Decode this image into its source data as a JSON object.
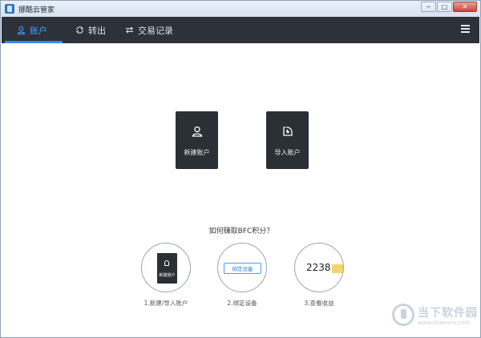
{
  "window": {
    "title": "挪酷云管家",
    "controls": {
      "minimize": "─",
      "maximize": "□",
      "close": "✕"
    }
  },
  "nav": {
    "tabs": [
      {
        "label": "账户",
        "icon": "user-icon",
        "active": true
      },
      {
        "label": "转出",
        "icon": "transfer-icon",
        "active": false
      },
      {
        "label": "交易记录",
        "icon": "exchange-icon",
        "active": false
      }
    ],
    "menu_icon": "menu-icon",
    "accent_color": "#2f8cff"
  },
  "actions": {
    "new_account": {
      "label": "新建账户",
      "icon": "user-icon"
    },
    "import_account": {
      "label": "导入账户",
      "icon": "import-icon"
    }
  },
  "howto": {
    "title": "如何赚取BFC积分？",
    "steps": [
      {
        "label": "1.新建/导入账户",
        "preview_text": "新建账户"
      },
      {
        "label": "2.绑定设备",
        "preview_text": "绑定设备"
      },
      {
        "label": "3.查看收益",
        "preview_value": "2238"
      }
    ]
  },
  "watermark": {
    "text": "当下软件园",
    "url": "www.downxia.com"
  }
}
